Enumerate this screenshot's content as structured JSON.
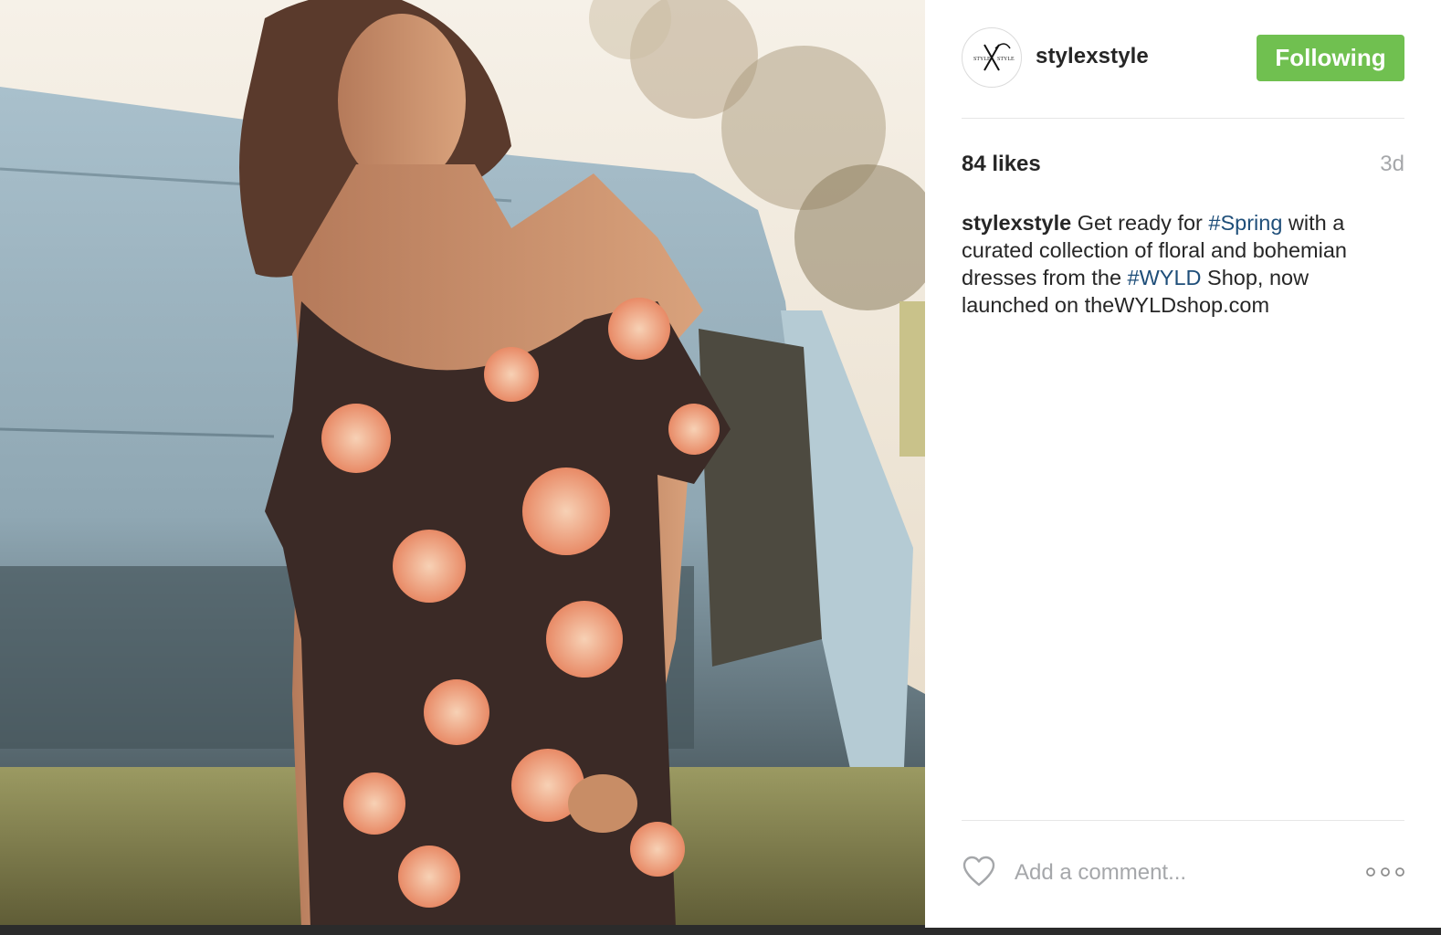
{
  "post": {
    "photo_alt": "",
    "username": "stylexstyle",
    "follow_button_label": "Following",
    "likes": "84 likes",
    "timestamp": "3d",
    "caption": {
      "username": "stylexstyle",
      "part1": " Get ready for ",
      "hashtag1": "#Spring",
      "part2": " with a curated collection of floral and bohemian dresses from the ",
      "hashtag2": "#WYLD",
      "part3": " Shop, now launched on theWYLDshop.com"
    },
    "comment_placeholder": "Add a comment...",
    "avatar_logo_text": "STYLE X STYLE"
  },
  "icons": {
    "heart": "heart-outline-icon",
    "more": "more-options-icon"
  },
  "colors": {
    "following_button": "#70c050",
    "hashtag": "#1e4e79",
    "muted_text": "#a5a7aa",
    "divider": "#e6e6e6"
  }
}
